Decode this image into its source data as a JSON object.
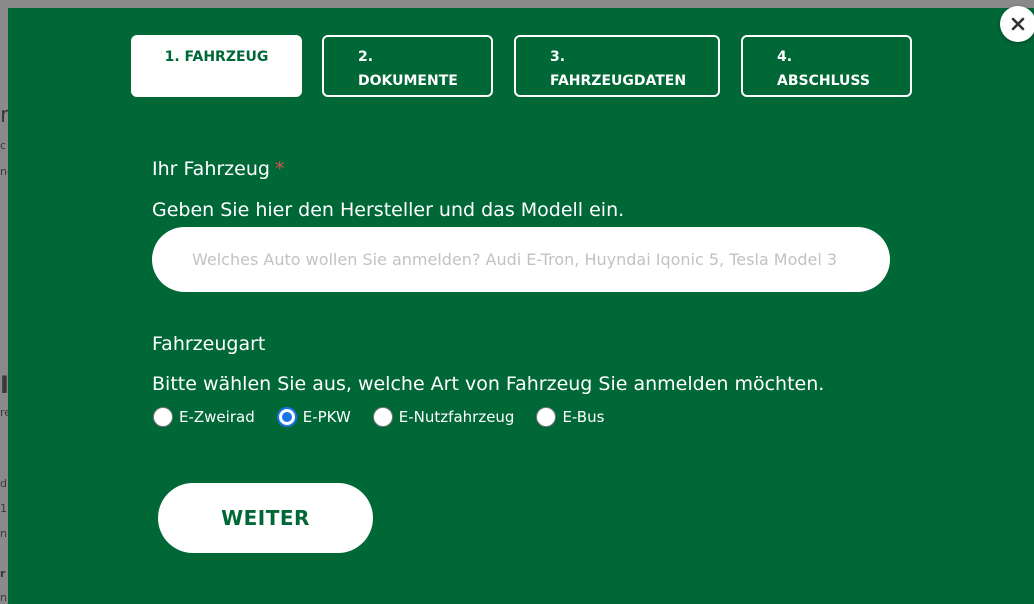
{
  "background_page": {
    "fragments": [
      "r",
      "c",
      "ne",
      "I",
      "re",
      "d",
      "1",
      "n",
      "r",
      "n"
    ]
  },
  "steps": [
    {
      "number": "1.",
      "label": "FAHRZEUG",
      "active": true
    },
    {
      "number": "2.",
      "label": "DOKUMENTE",
      "active": false
    },
    {
      "number": "3.",
      "label": "FAHRZEUGDATEN",
      "active": false
    },
    {
      "number": "4.",
      "label": "ABSCHLUSS",
      "active": false
    }
  ],
  "vehicle": {
    "label": "Ihr Fahrzeug",
    "required_marker": "*",
    "hint": "Geben Sie hier den Hersteller und das Modell ein.",
    "input_value": "",
    "input_placeholder": "Welches Auto wollen Sie anmelden? Audi E-Tron, Huyndai Iqonic 5, Tesla Model 3"
  },
  "vehicle_type": {
    "label": "Fahrzeugart",
    "hint": "Bitte wählen Sie aus, welche Art von Fahrzeug Sie anmelden möchten.",
    "options": [
      {
        "label": "E-Zweirad",
        "checked": false
      },
      {
        "label": "E-PKW",
        "checked": true
      },
      {
        "label": "E-Nutzfahrzeug",
        "checked": false
      },
      {
        "label": "E-Bus",
        "checked": false
      }
    ]
  },
  "actions": {
    "next_label": "WEITER",
    "close_icon": "close-icon"
  },
  "colors": {
    "modal_green": "#006837",
    "required_red": "#d9534f",
    "radio_blue": "#1a73e8"
  }
}
